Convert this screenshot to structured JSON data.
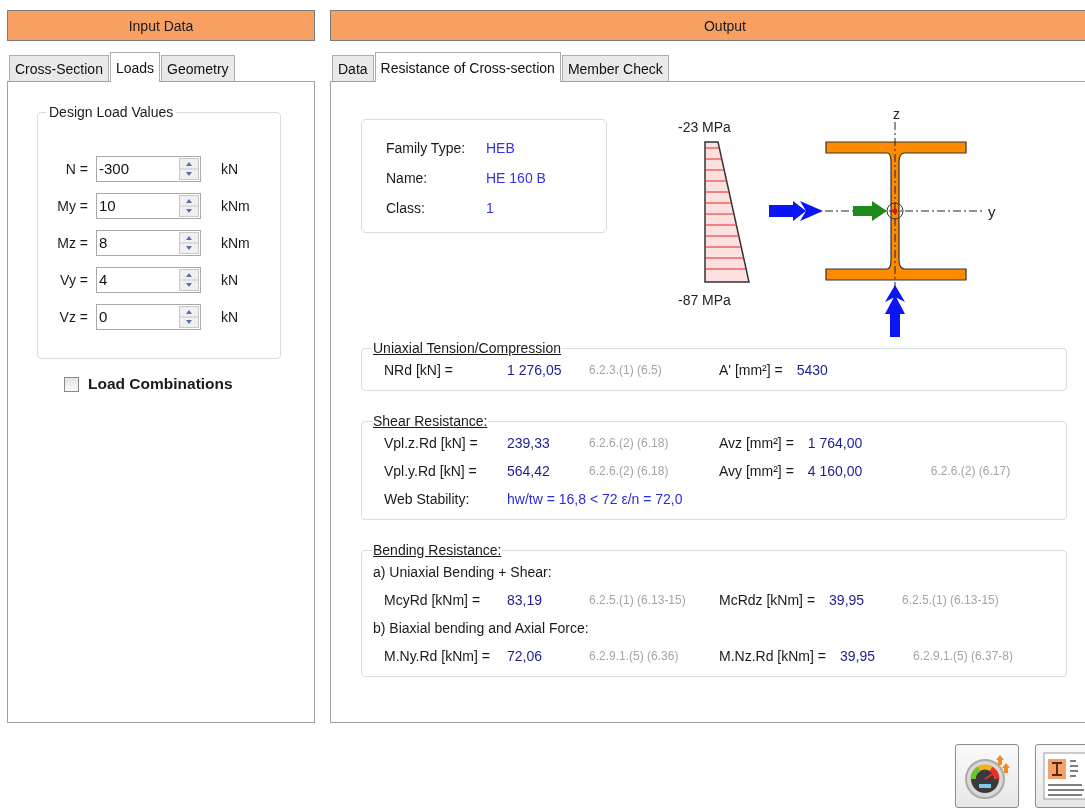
{
  "input_panel": {
    "title": "Input Data",
    "tabs": [
      {
        "label": "Cross-Section",
        "selected": false
      },
      {
        "label": "Loads",
        "selected": true
      },
      {
        "label": "Geometry",
        "selected": false
      }
    ],
    "design_loads": {
      "title": "Design Load Values",
      "fields": [
        {
          "label": "N =",
          "value": "-300",
          "unit": "kN"
        },
        {
          "label": "My =",
          "value": "10",
          "unit": "kNm"
        },
        {
          "label": "Mz =",
          "value": "8",
          "unit": "kNm"
        },
        {
          "label": "Vy =",
          "value": "4",
          "unit": "kN"
        },
        {
          "label": "Vz =",
          "value": "0",
          "unit": "kN"
        }
      ]
    },
    "load_combinations": {
      "label": "Load Combinations",
      "checked": false
    }
  },
  "output_panel": {
    "title": "Output",
    "tabs": [
      {
        "label": "Data",
        "selected": false
      },
      {
        "label": "Resistance of Cross-section",
        "selected": true
      },
      {
        "label": "Member Check",
        "selected": false
      }
    ],
    "section_info": [
      {
        "label": "Family Type:",
        "value": "HEB"
      },
      {
        "label": "Name:",
        "value": "HE 160 B"
      },
      {
        "label": "Class:",
        "value": "1"
      }
    ],
    "stress_diagram": {
      "top": "-23 MPa",
      "bottom": "-87 MPa"
    },
    "section_drawing": {
      "z_axis": "z",
      "y_axis": "y"
    },
    "groups": [
      {
        "title": "Uniaxial Tension/Compression",
        "rows": [
          [
            {
              "kind": "label",
              "text": "NRd [kN] ="
            },
            {
              "kind": "value",
              "text": "1 276,05"
            },
            {
              "kind": "ref",
              "text": "6.2.3.(1) (6.5)"
            },
            {
              "kind": "label",
              "text": "A' [mm²] ="
            },
            {
              "kind": "value",
              "text": "5430"
            }
          ]
        ]
      },
      {
        "title": "Shear Resistance:",
        "side_ref": "6.2.6.(2) (6.17)",
        "rows": [
          [
            {
              "kind": "label",
              "text": "Vpl.z.Rd [kN] ="
            },
            {
              "kind": "value",
              "text": "239,33"
            },
            {
              "kind": "ref",
              "text": "6.2.6.(2) (6.18)"
            },
            {
              "kind": "label",
              "text": "Avz [mm²] ="
            },
            {
              "kind": "value",
              "text": "1 764,00"
            }
          ],
          [
            {
              "kind": "label",
              "text": "Vpl.y.Rd [kN] ="
            },
            {
              "kind": "value",
              "text": "564,42"
            },
            {
              "kind": "ref",
              "text": "6.2.6.(2) (6.18)"
            },
            {
              "kind": "label",
              "text": "Avy [mm²] ="
            },
            {
              "kind": "value",
              "text": "4 160,00"
            }
          ],
          [
            {
              "kind": "label",
              "text": "Web Stability:"
            },
            {
              "kind": "check",
              "text": "hw/tw = 16,8 < 72 ε/n = 72,0"
            }
          ]
        ]
      },
      {
        "title": "Bending Resistance:",
        "rows": [
          [
            {
              "kind": "heading",
              "text": "a) Uniaxial Bending + Shear:"
            }
          ],
          [
            {
              "kind": "label",
              "text": "McyRd [kNm] ="
            },
            {
              "kind": "value",
              "text": "83,19"
            },
            {
              "kind": "ref",
              "text": "6.2.5.(1) (6.13-15)"
            },
            {
              "kind": "label",
              "text": "McRdz [kNm] ="
            },
            {
              "kind": "value",
              "text": "39,95"
            },
            {
              "kind": "ref",
              "text": "6.2.5.(1) (6.13-15)"
            }
          ],
          [
            {
              "kind": "heading",
              "text": "b) Biaxial bending and Axial Force:"
            }
          ],
          [
            {
              "kind": "label",
              "text": "M.Ny.Rd [kNm] ="
            },
            {
              "kind": "value",
              "text": "72,06"
            },
            {
              "kind": "ref",
              "text": "6.2.9.1.(5) (6.36)"
            },
            {
              "kind": "label",
              "text": "M.Nz.Rd [kNm] ="
            },
            {
              "kind": "value",
              "text": "39,95"
            },
            {
              "kind": "ref",
              "text": "6.2.9.1.(5) (6.37-8)"
            }
          ]
        ]
      }
    ]
  }
}
